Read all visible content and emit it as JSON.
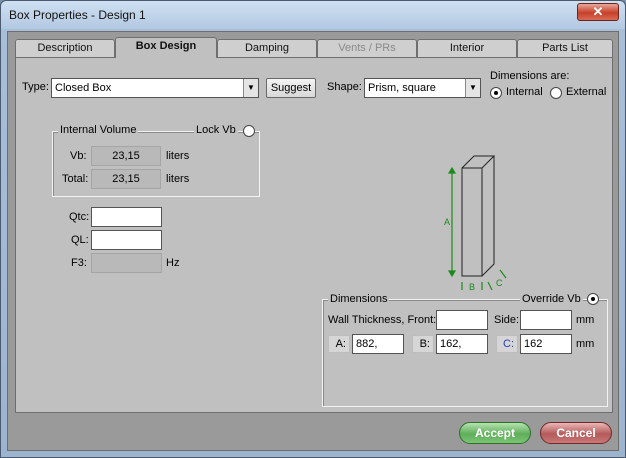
{
  "window": {
    "title": "Box Properties - Design 1",
    "close_glyph": "✕"
  },
  "tabs": [
    {
      "label": "Description"
    },
    {
      "label": "Box Design"
    },
    {
      "label": "Damping"
    },
    {
      "label": "Vents / PRs"
    },
    {
      "label": "Interior"
    },
    {
      "label": "Parts List"
    }
  ],
  "type": {
    "label": "Type:",
    "value": "Closed Box",
    "suggest_label": "Suggest"
  },
  "shape": {
    "label": "Shape:",
    "value": "Prism, square"
  },
  "dimensions_are": {
    "label": "Dimensions are:",
    "internal_label": "Internal",
    "external_label": "External",
    "selected": "Internal"
  },
  "internal_volume": {
    "title": "Internal Volume",
    "lock_label": "Lock Vb",
    "vb_label": "Vb:",
    "vb_value": "23,15",
    "vb_unit": "liters",
    "total_label": "Total:",
    "total_value": "23,15",
    "total_unit": "liters"
  },
  "params": {
    "qtc_label": "Qtc:",
    "qtc_value": "",
    "ql_label": "QL:",
    "ql_value": "",
    "f3_label": "F3:",
    "f3_value": "",
    "f3_unit": "Hz"
  },
  "diagram": {
    "label_a": "A",
    "label_b": "B",
    "label_c": "C"
  },
  "dimensions": {
    "title": "Dimensions",
    "override_label": "Override Vb",
    "wall_front_label": "Wall Thickness, Front:",
    "wall_front_value": "",
    "side_label": "Side:",
    "side_value": "",
    "side_unit": "mm",
    "a_label": "A:",
    "a_value": "882,",
    "b_label": "B:",
    "b_value": "162,",
    "c_label": "C:",
    "c_value": "162",
    "unit": "mm"
  },
  "buttons": {
    "accept": "Accept",
    "cancel": "Cancel"
  }
}
